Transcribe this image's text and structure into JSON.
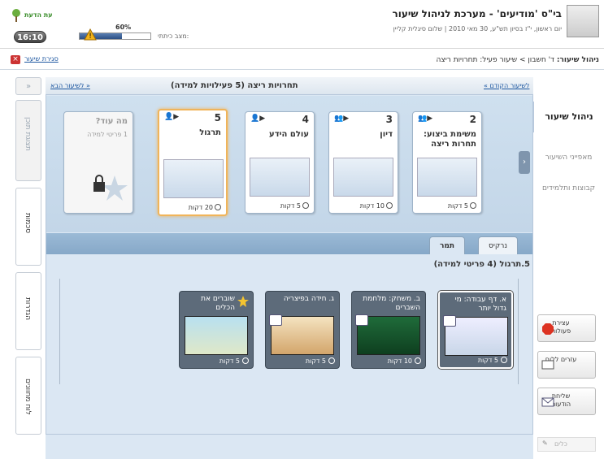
{
  "header": {
    "app_title": "בי\"ס 'מודיעים' - מערכת לניהול שיעור",
    "date_line": "יום ראשון, י\"ז בסיון תש\"ע, 30 מאי 2010 | שלום סיגלית קליין",
    "tree_label": "עת הדעת",
    "clock": "16:10",
    "progress_percent_label": "60%",
    "progress_value": 0.6,
    "status_label": "מצב כיתתי:"
  },
  "bar2": {
    "close_lesson": "סגירת שיעור",
    "breadcrumb_title": "ניהול שיעור:",
    "breadcrumb_path": "ד' חשבון > שיעור פעיל: תחרויות ריצה"
  },
  "left_tabs": [
    {
      "label": "תצוגת תוכן",
      "state": "disabled"
    },
    {
      "label": "סכמות",
      "state": "active"
    },
    {
      "label": "הגדרות",
      "state": "inactive"
    },
    {
      "label": "לוח מחוונים",
      "state": "inactive"
    }
  ],
  "right_nav": {
    "active": "ניהול שיעור",
    "items": [
      "מאפייני השיעור",
      "קבוצות ותלמידים"
    ],
    "buttons": [
      "עצירת פעולות",
      "עזרים ללוח",
      "שליחת הודעות"
    ],
    "search_placeholder": "כלים"
  },
  "activities_panel": {
    "title": "תחרויות ריצה (5 פעילויות למידה)",
    "next_label": "לשיעור הבא »",
    "prev_label": "« לשיעור הקודם",
    "cards": [
      {
        "num": "2",
        "name": "משימת ביצוע: תחרות ריצה",
        "time": "5 דקות"
      },
      {
        "num": "3",
        "name": "דיון",
        "time": "10 דקות"
      },
      {
        "num": "4",
        "name": "עולם הידע",
        "time": "5 דקות"
      },
      {
        "num": "5",
        "name": "תרגול",
        "time": "20 דקות"
      },
      {
        "num": "",
        "name": "מה עוד?",
        "sub": "1 פריטי למידה",
        "time": ""
      }
    ]
  },
  "tabs": [
    "תמר",
    "נרקיס"
  ],
  "section_title": "5.תרגול (4 פריטי למידה)",
  "items": [
    {
      "name": "א. דף עבודה: מי גדול יותר",
      "time": "5 דקות"
    },
    {
      "name": "ב. משחק: מלחמת השברים",
      "time": "10 דקות"
    },
    {
      "name": "ג. חידה בפיצריה",
      "time": "5 דקות"
    },
    {
      "name": "שוברים את הכלים",
      "time": "5 דקות"
    }
  ],
  "colors": {
    "accent": "#1c56a0",
    "selected_border": "#f0b45a",
    "item_bg": "#5d6b7a"
  }
}
